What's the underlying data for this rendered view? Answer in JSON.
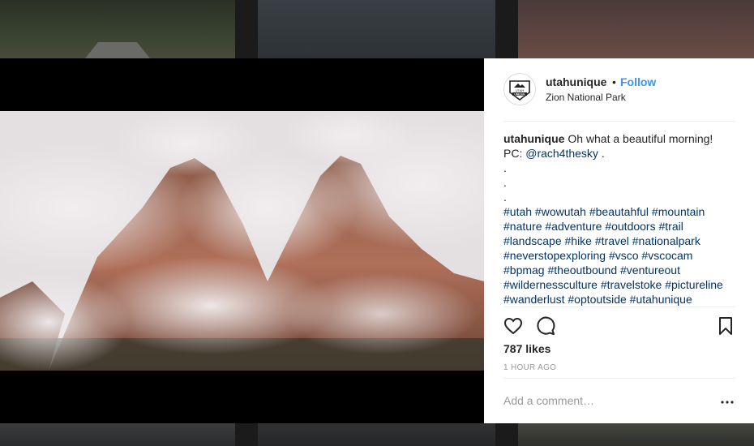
{
  "post": {
    "username": "utahunique",
    "separator": "•",
    "follow_label": "Follow",
    "location": "Zion National Park",
    "avatar_text": [
      "UTAH",
      "UNIQUE"
    ],
    "caption": {
      "user": "utahunique",
      "text": "Oh what a beautiful morning!",
      "pc_prefix": "PC:",
      "mention": "@rach4thesky",
      "pc_suffix": ".",
      "dots": [
        ".",
        ".",
        "."
      ],
      "hashtag_lines": [
        "#utah #wowutah #beautahful #mountain",
        "#nature #adventure #outdoors #trail",
        "#landscape #hike #travel #nationalpark",
        "#neverstopexploring #vsco #vscocam",
        "#bpmag #theoutbound #ventureout",
        "#wildernessculture #travelstoke #pictureline",
        "#wanderlust #optoutside #utahunique"
      ]
    },
    "likes": "787 likes",
    "time": "1 HOUR AGO",
    "comment_placeholder": "Add a comment…"
  },
  "icons": {
    "like": "heart-icon",
    "comment": "speech-bubble-icon",
    "save": "bookmark-icon",
    "more": "ellipsis-icon",
    "tagged": "user-tag-icon"
  },
  "colors": {
    "follow": "#3897f0",
    "hashtag": "#003569",
    "text": "#262626",
    "muted": "#999999"
  }
}
